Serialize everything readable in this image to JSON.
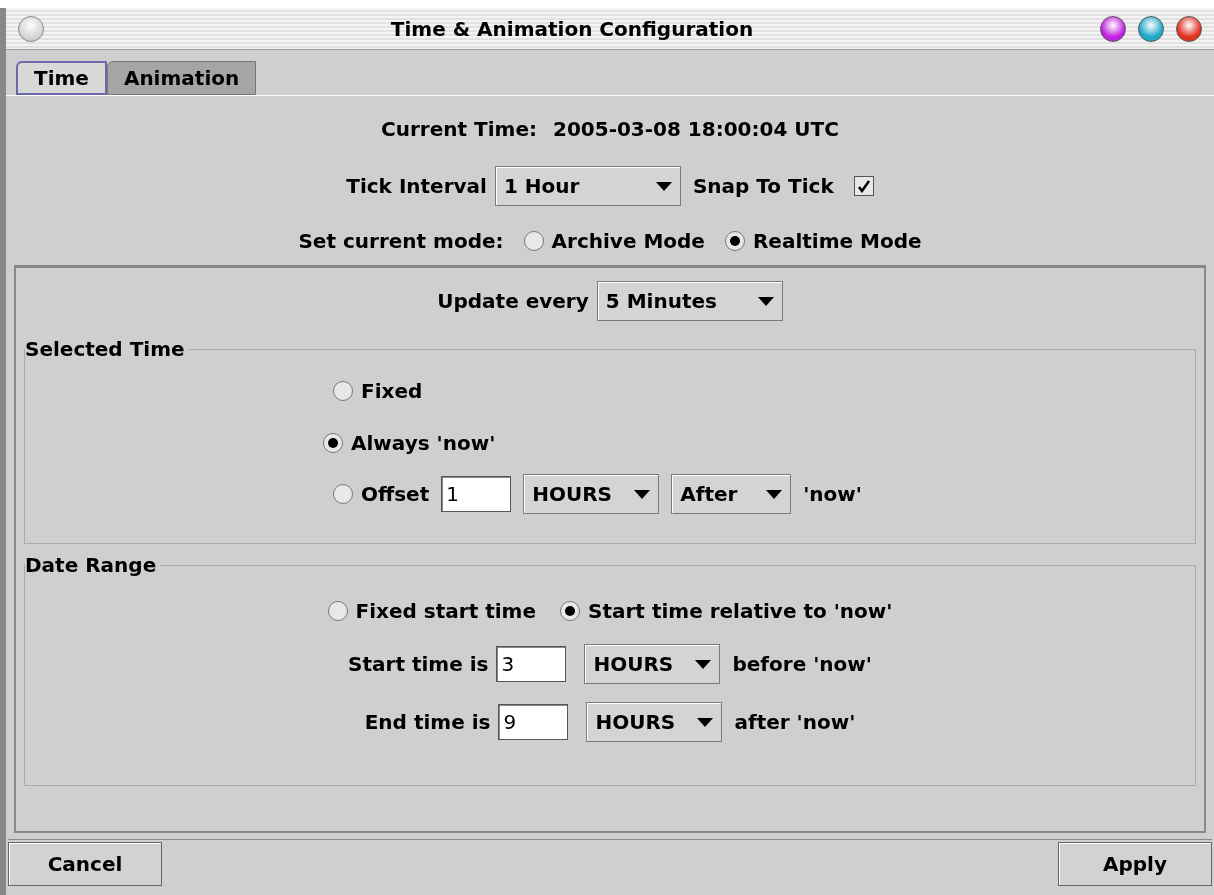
{
  "window": {
    "title": "Time & Animation Configuration"
  },
  "tabs": [
    {
      "label": "Time",
      "selected": true
    },
    {
      "label": "Animation",
      "selected": false
    }
  ],
  "current_time": {
    "label": "Current Time:",
    "value": "2005-03-08 18:00:04 UTC"
  },
  "tick_interval": {
    "label": "Tick Interval",
    "value": "1 Hour"
  },
  "snap_to_tick": {
    "label": "Snap To Tick",
    "checked": true
  },
  "mode": {
    "label": "Set current mode:",
    "options": [
      {
        "label": "Archive Mode",
        "selected": false
      },
      {
        "label": "Realtime Mode",
        "selected": true
      }
    ]
  },
  "update_every": {
    "label": "Update every",
    "value": "5 Minutes"
  },
  "selected_time": {
    "title": "Selected Time",
    "options": [
      {
        "kind": "plain",
        "label": "Fixed",
        "selected": false
      },
      {
        "kind": "plain",
        "label": "Always 'now'",
        "selected": true
      },
      {
        "kind": "offset",
        "label": "Offset",
        "selected": false,
        "amount": "1",
        "unit": "HOURS",
        "direction": "After",
        "suffix": "'now'"
      }
    ]
  },
  "date_range": {
    "title": "Date Range",
    "options": [
      {
        "label": "Fixed start time",
        "selected": false
      },
      {
        "label": "Start time relative to 'now'",
        "selected": true
      }
    ],
    "rows": [
      {
        "label": "Start time is",
        "value": "3",
        "unit": "HOURS",
        "suffix": "before 'now'"
      },
      {
        "label": "End time is",
        "value": "9",
        "unit": "HOURS",
        "suffix": "after 'now'"
      }
    ]
  },
  "buttons": [
    "Cancel",
    "Apply"
  ]
}
